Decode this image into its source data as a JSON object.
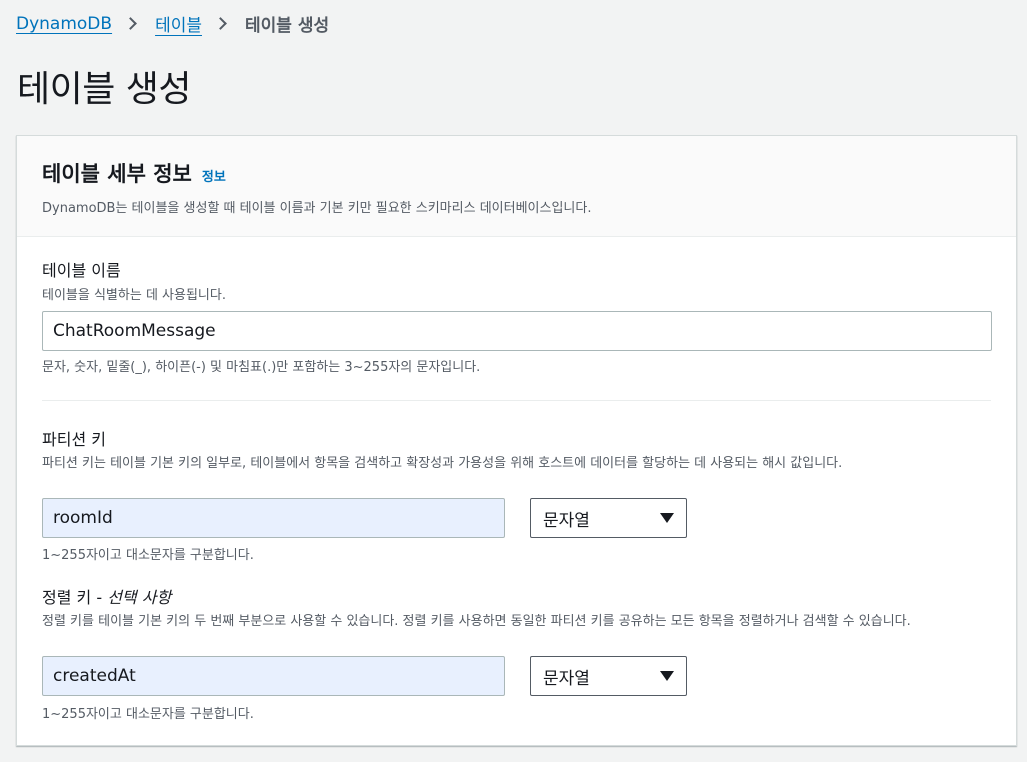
{
  "breadcrumb": {
    "items": [
      {
        "label": "DynamoDB"
      },
      {
        "label": "테이블"
      }
    ],
    "current": "테이블 생성"
  },
  "page": {
    "title": "테이블 생성"
  },
  "panel": {
    "title": "테이블 세부 정보",
    "info": "정보",
    "description": "DynamoDB는 테이블을 생성할 때 테이블 이름과 기본 키만 필요한 스키마리스 데이터베이스입니다."
  },
  "table_name": {
    "label": "테이블 이름",
    "description": "테이블을 식별하는 데 사용됩니다.",
    "value": "ChatRoomMessage",
    "hint": "문자, 숫자, 밑줄(_), 하이픈(-) 및 마침표(.)만 포함하는 3~255자의 문자입니다."
  },
  "partition_key": {
    "label": "파티션 키",
    "description": "파티션 키는 테이블 기본 키의 일부로, 테이블에서 항목을 검색하고 확장성과 가용성을 위해 호스트에 데이터를 할당하는 데 사용되는 해시 값입니다.",
    "value": "roomId",
    "type": "문자열",
    "hint": "1~255자이고 대소문자를 구분합니다."
  },
  "sort_key": {
    "label": "정렬 키 - ",
    "label_optional": "선택 사항",
    "description": "정렬 키를 테이블 기본 키의 두 번째 부분으로 사용할 수 있습니다. 정렬 키를 사용하면 동일한 파티션 키를 공유하는 모든 항목을 정렬하거나 검색할 수 있습니다.",
    "value": "createdAt",
    "type": "문자열",
    "hint": "1~255자이고 대소문자를 구분합니다."
  }
}
